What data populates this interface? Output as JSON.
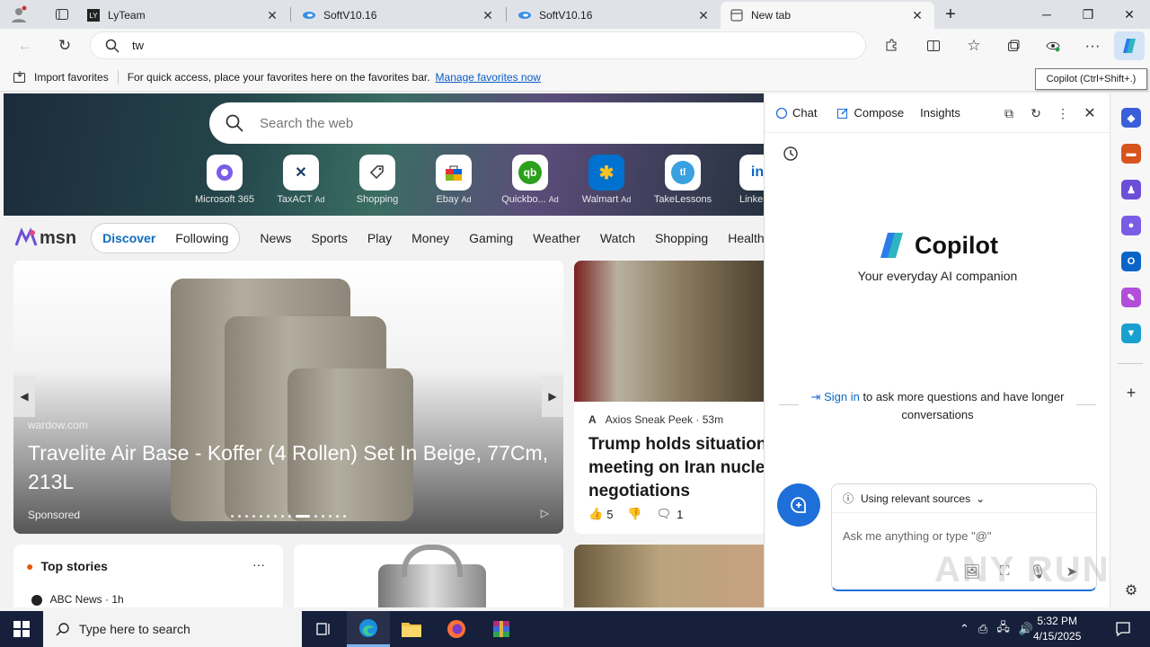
{
  "tabs": [
    {
      "title": "LyTeam"
    },
    {
      "title": "SoftV10.16"
    },
    {
      "title": "SoftV10.16"
    },
    {
      "title": "New tab"
    }
  ],
  "address": {
    "value": "tw"
  },
  "favorites_bar": {
    "import_label": "Import favorites",
    "message": "For quick access, place your favorites here on the favorites bar.",
    "manage_link": "Manage favorites now"
  },
  "tooltip": "Copilot (Ctrl+Shift+.)",
  "newtab": {
    "search_placeholder": "Search the web",
    "quick_links": [
      {
        "label": "Microsoft 365",
        "ad": ""
      },
      {
        "label": "TaxACT",
        "ad": "Ad"
      },
      {
        "label": "Shopping",
        "ad": ""
      },
      {
        "label": "Ebay",
        "ad": "Ad"
      },
      {
        "label": "Quickbo...",
        "ad": "Ad"
      },
      {
        "label": "Walmart",
        "ad": "Ad"
      },
      {
        "label": "TakeLessons",
        "ad": ""
      },
      {
        "label": "Linke",
        "ad": ""
      }
    ],
    "msn": {
      "logo": "msn",
      "discover": "Discover",
      "following": "Following",
      "nav": [
        "News",
        "Sports",
        "Play",
        "Money",
        "Gaming",
        "Weather",
        "Watch",
        "Shopping",
        "Health"
      ]
    },
    "feature": {
      "source": "wardow.com",
      "title": "Travelite Air Base - Koffer (4 Rollen) Set In Beige, 77Cm, 213L",
      "sponsored": "Sponsored"
    },
    "story": {
      "publisher": "Axios Sneak Peek · 53m",
      "headline_lines": [
        "Trump holds situation",
        "meeting on Iran nucle",
        "negotiations"
      ],
      "likes": "5",
      "comments": "1"
    },
    "top_stories": {
      "title": "Top stories",
      "more": "···",
      "first_source": "ABC News · 1h"
    }
  },
  "copilot": {
    "tabs": [
      "Chat",
      "Compose",
      "Insights"
    ],
    "name": "Copilot",
    "subtitle": "Your everyday AI companion",
    "sign_in_link": "Sign in",
    "sign_in_rest": "to ask more questions and have longer conversations",
    "sources_label": "Using relevant sources",
    "input_placeholder": "Ask me anything or type \"@\""
  },
  "taskbar": {
    "search_placeholder": "Type here to search",
    "time": "5:32 PM",
    "date": "4/15/2025"
  },
  "watermark": "ANY RUN",
  "colors": {
    "accent": "#0f6cbd",
    "copilot_blue": "#1e6fd9",
    "taskbar": "#16203a"
  }
}
